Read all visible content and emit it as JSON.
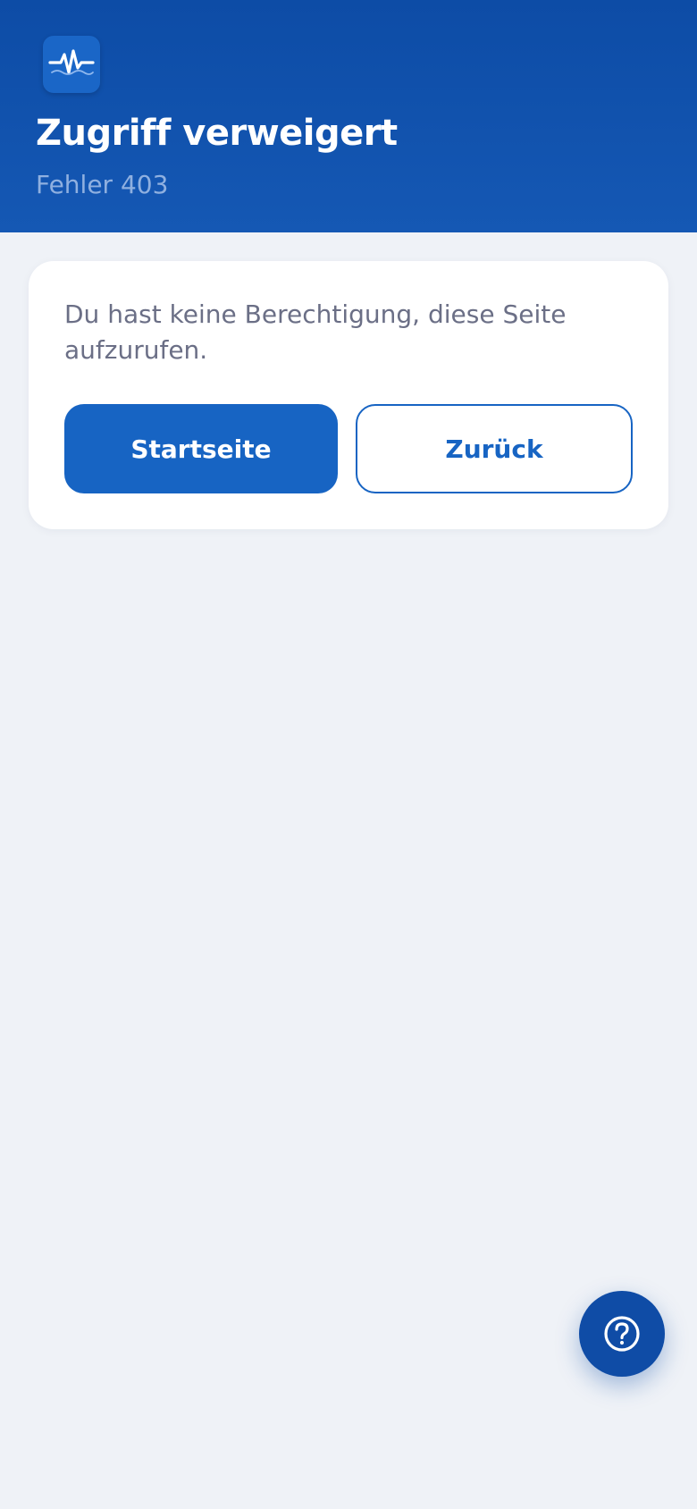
{
  "header": {
    "app_icon": "pulse-wave-icon",
    "title": "Zugriff verweigert",
    "subtitle": "Fehler 403"
  },
  "card": {
    "message": "Du hast keine Berechtigung, diese Seite aufzurufen.",
    "primary_button": "Startseite",
    "secondary_button": "Zurück"
  },
  "help_button": {
    "icon": "question-circle-icon"
  },
  "colors": {
    "header_bg": "#0d4ca6",
    "accent": "#1764c3",
    "page_bg": "#eff2f7",
    "text_muted": "#6b6f86"
  }
}
